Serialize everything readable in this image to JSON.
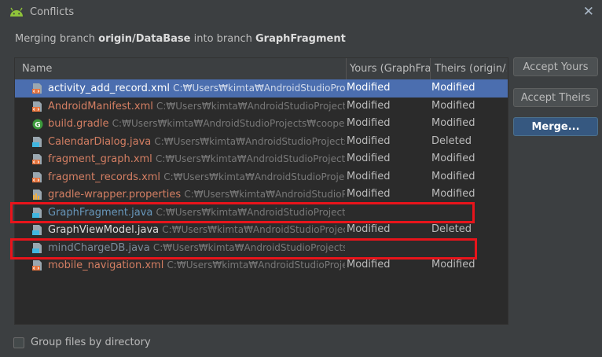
{
  "window": {
    "title": "Conflicts",
    "icon": "android-icon",
    "close_glyph": "✕"
  },
  "subtitle": {
    "prefix": "Merging branch ",
    "source": "origin/DataBase",
    "middle": " into branch ",
    "target": "GraphFragment"
  },
  "table": {
    "columns": [
      "Name",
      "Yours (GraphFra...",
      "Theirs (origin/..."
    ],
    "rows": [
      {
        "name": "activity_add_record.xml",
        "path": "C:₩Users₩kimta₩AndroidStudioProjects₩",
        "yours": "Modified",
        "theirs": "Modified",
        "icon": "xml-file-icon",
        "color": "#dcdcdc",
        "selected": true
      },
      {
        "name": "AndroidManifest.xml",
        "path": "C:₩Users₩kimta₩AndroidStudioProjects₩c",
        "yours": "Modified",
        "theirs": "Modified",
        "icon": "xml-file-icon",
        "color": "#d47f63",
        "selected": false
      },
      {
        "name": "build.gradle",
        "path": "C:₩Users₩kimta₩AndroidStudioProjects₩cooperati",
        "yours": "Modified",
        "theirs": "Modified",
        "icon": "gradle-icon",
        "color": "#d47f63",
        "selected": false
      },
      {
        "name": "CalendarDialog.java",
        "path": "C:₩Users₩kimta₩AndroidStudioProjects₩cc",
        "yours": "Modified",
        "theirs": "Deleted",
        "icon": "java-file-icon",
        "color": "#d47f63",
        "selected": false
      },
      {
        "name": "fragment_graph.xml",
        "path": "C:₩Users₩kimta₩AndroidStudioProjects₩c",
        "yours": "Modified",
        "theirs": "Modified",
        "icon": "xml-file-icon",
        "color": "#d47f63",
        "selected": false
      },
      {
        "name": "fragment_records.xml",
        "path": "C:₩Users₩kimta₩AndroidStudioProjects₩c",
        "yours": "Modified",
        "theirs": "Modified",
        "icon": "xml-file-icon",
        "color": "#d47f63",
        "selected": false
      },
      {
        "name": "gradle-wrapper.properties",
        "path": "C:₩Users₩kimta₩AndroidStudioProje",
        "yours": "Modified",
        "theirs": "Modified",
        "icon": "properties-file-icon",
        "color": "#d47f63",
        "selected": false
      },
      {
        "name": "GraphFragment.java",
        "path": "C:₩Users₩kimta₩AndroidStudioProjects₩cc",
        "yours": "",
        "theirs": "",
        "icon": "java-file-icon",
        "color": "#6897bb",
        "selected": false
      },
      {
        "name": "GraphViewModel.java",
        "path": "C:₩Users₩kimta₩AndroidStudioProjects₩",
        "yours": "Modified",
        "theirs": "Deleted",
        "icon": "java-file-icon",
        "color": "#dcdcdc",
        "selected": false
      },
      {
        "name": "mindChargeDB.java",
        "path": "C:₩Users₩kimta₩AndroidStudioProjects₩cc",
        "yours": "",
        "theirs": "",
        "icon": "java-file-icon",
        "color": "#7d8b99",
        "selected": false
      },
      {
        "name": "mobile_navigation.xml",
        "path": "C:₩Users₩kimta₩AndroidStudioProjects₩",
        "yours": "Modified",
        "theirs": "Modified",
        "icon": "xml-file-icon",
        "color": "#d47f63",
        "selected": false
      }
    ]
  },
  "buttons": {
    "accept_yours": "Accept Yours",
    "accept_theirs": "Accept Theirs",
    "merge": "Merge..."
  },
  "checkbox": {
    "label": "Group files by directory",
    "checked": false
  },
  "colors": {
    "background": "#3c3f41",
    "table_bg": "#2b2b2b",
    "selection": "#4b6eaf",
    "highlight_box": "#e8141b",
    "android_green": "#8fc33a"
  }
}
